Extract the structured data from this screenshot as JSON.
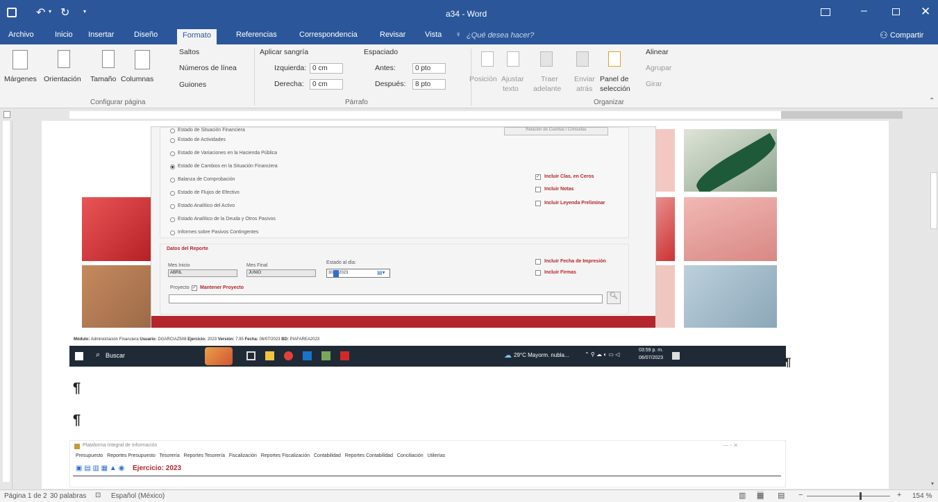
{
  "window": {
    "title": "a34 - Word",
    "share_label": "Compartir"
  },
  "tabs": [
    "Archivo",
    "Inicio",
    "Insertar",
    "Diseño",
    "Formato",
    "Referencias",
    "Correspondencia",
    "Revisar",
    "Vista"
  ],
  "active_tab": "Formato",
  "tell_me": "¿Qué desea hacer?",
  "ribbon": {
    "page_setup": {
      "margins": "Márgenes",
      "orientation": "Orientación",
      "size": "Tamaño",
      "columns": "Columnas",
      "breaks": "Saltos",
      "line_numbers": "Números de línea",
      "hyphenation": "Guiones",
      "group_label": "Configurar página"
    },
    "paragraph": {
      "indent_title": "Aplicar sangría",
      "spacing_title": "Espaciado",
      "left_label": "Izquierda:",
      "left_value": "0 cm",
      "right_label": "Derecha:",
      "right_value": "0 cm",
      "before_label": "Antes:",
      "before_value": "0 pto",
      "after_label": "Después:",
      "after_value": "8 pto",
      "group_label": "Párrafo"
    },
    "arrange": {
      "position": "Posición",
      "wrap_text_1": "Ajustar",
      "wrap_text_2": "texto",
      "bring_forward_1": "Traer",
      "bring_forward_2": "adelante",
      "send_backward_1": "Enviar",
      "send_backward_2": "atrás",
      "selection_pane_1": "Panel de",
      "selection_pane_2": "selección",
      "align": "Alinear",
      "group": "Agrupar",
      "rotate": "Girar",
      "group_label": "Organizar"
    }
  },
  "dialog": {
    "top_button": "Relación de Cuentas / Consultas",
    "reports": [
      "Estado de Situación Financiera",
      "Estado de Actividades",
      "Estado de Variaciones en la Hacienda Pública",
      "Estado de Cambios en la Situación Financiera",
      "Balanza de Comprobación",
      "Estado de Flujos de Efectivo",
      "Estado Analítico del Activo",
      "Estado Analítico de la Deuda y Otros Pasivos",
      "Informes sobre Pasivos Contingentes"
    ],
    "selected_report": 3,
    "options": [
      {
        "label": "Incluir Clas. en Ceros",
        "checked": true
      },
      {
        "label": "Incluir Notas",
        "checked": false
      },
      {
        "label": "Incluir Leyenda Preliminar",
        "checked": false
      }
    ],
    "section_title": "Datos del Reporte",
    "start_month_label": "Mes Inicio",
    "start_month": "ABRIL",
    "end_month_label": "Mes Final",
    "end_month": "JUNIO",
    "date_label": "Estado al día:",
    "date_value": "30/06/2023",
    "date_value_display": "30/   /2023",
    "print_options": [
      {
        "label": "Incluir Fecha de Impresión",
        "checked": false
      },
      {
        "label": "Incluir Firmas",
        "checked": false
      }
    ],
    "project_label": "Proyecto",
    "keep_project_label": "Mantener Proyecto",
    "keep_project_checked": true
  },
  "app_status": {
    "module_label": "Módulo:",
    "module": "Administración Financiera",
    "user_label": "Usuario:",
    "user": "DGARCIAZ508",
    "year_label": "Ejercicio:",
    "year": "2023",
    "version_label": "Versión:",
    "version": "7.95",
    "date_label": "Fecha:",
    "date": "06/07/2023",
    "db_label": "BD:",
    "db": "PIAFAREA2023"
  },
  "taskbar": {
    "search": "Buscar",
    "weather": "29°C  Mayorm. nubla...",
    "time": "03:59 p. m.",
    "date": "06/07/2023"
  },
  "app2": {
    "title": "Plataforma Integral de Información",
    "menu": [
      "Presupuesto",
      "Reportes Presupuesto",
      "Tesorería",
      "Reportes Tesorería",
      "Fiscalización",
      "Reportes Fiscalización",
      "Contabilidad",
      "Reportes Contabilidad",
      "Conciliación",
      "Utilerías"
    ],
    "year_label": "Ejercicio: 2023"
  },
  "pilcrow": "¶",
  "status_bar": {
    "page": "Página 1 de 2",
    "words": "30 palabras",
    "language": "Español (México)",
    "zoom": "154 %"
  },
  "colors": {
    "word_blue": "#2b579a",
    "dialog_red": "#b3262b",
    "taskbar": "#1f2a36"
  }
}
